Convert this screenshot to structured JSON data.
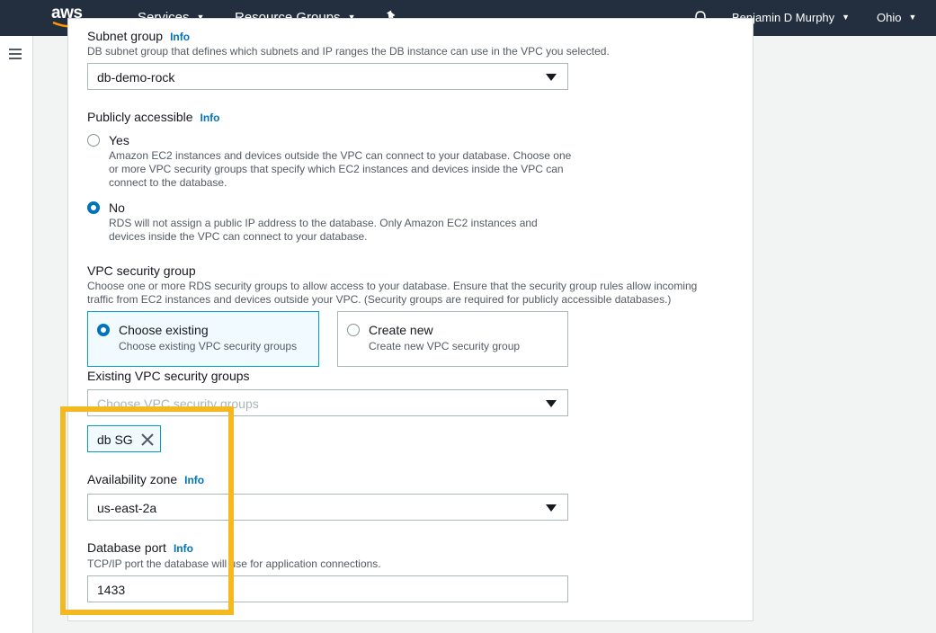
{
  "nav": {
    "logo": "aws",
    "services": "Services",
    "resource_groups": "Resource Groups",
    "user": "Benjamin D Murphy",
    "region": "Ohio"
  },
  "subnet_group": {
    "label": "Subnet group",
    "info": "Info",
    "description": "DB subnet group that defines which subnets and IP ranges the DB instance can use in the VPC you selected.",
    "value": "db-demo-rock"
  },
  "public_access": {
    "label": "Publicly accessible",
    "info": "Info",
    "yes_label": "Yes",
    "yes_desc": "Amazon EC2 instances and devices outside the VPC can connect to your database. Choose one or more VPC security groups that specify which EC2 instances and devices inside the VPC can connect to the database.",
    "no_label": "No",
    "no_desc": "RDS will not assign a public IP address to the database. Only Amazon EC2 instances and devices inside the VPC can connect to your database.",
    "selected": "No"
  },
  "vpc_security_group": {
    "label": "VPC security group",
    "description": "Choose one or more RDS security groups to allow access to your database. Ensure that the security group rules allow incoming traffic from EC2 instances and devices outside your VPC. (Security groups are required for publicly accessible databases.)",
    "choose_existing": {
      "title": "Choose existing",
      "desc": "Choose existing VPC security groups"
    },
    "create_new": {
      "title": "Create new",
      "desc": "Create new VPC security group"
    },
    "selected": "Choose existing"
  },
  "existing_groups": {
    "label": "Existing VPC security groups",
    "placeholder": "Choose VPC security groups",
    "tokens": [
      "db SG"
    ]
  },
  "availability_zone": {
    "label": "Availability zone",
    "info": "Info",
    "value": "us-east-2a"
  },
  "database_port": {
    "label": "Database port",
    "info": "Info",
    "description": "TCP/IP port the database will use for application connections.",
    "value": "1433"
  },
  "colors": {
    "nav_bg": "#232f3e",
    "accent": "#0073bb",
    "highlight": "#f4b820"
  }
}
